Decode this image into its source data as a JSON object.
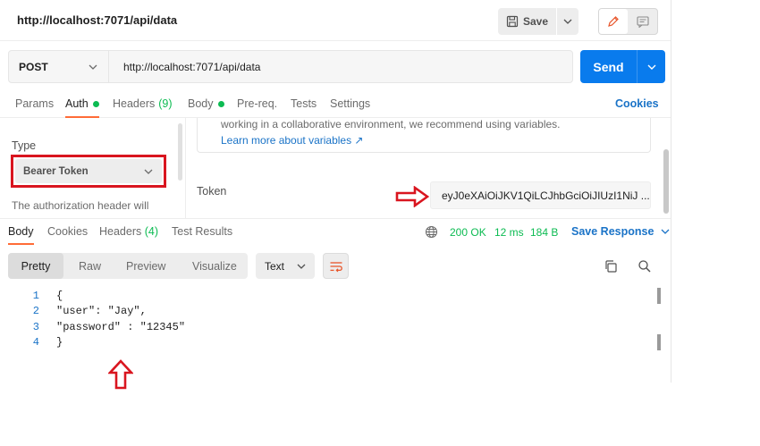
{
  "window": {
    "title": "http://localhost:7071/api/data"
  },
  "toolbar": {
    "save_label": "Save"
  },
  "request": {
    "method": "POST",
    "url": "http://localhost:7071/api/data",
    "send_label": "Send"
  },
  "request_tabs": {
    "params": "Params",
    "auth": "Auth",
    "headers": "Headers",
    "headers_count": "(9)",
    "body": "Body",
    "prereq": "Pre-req.",
    "tests": "Tests",
    "settings": "Settings",
    "cookies": "Cookies"
  },
  "auth": {
    "type_label": "Type",
    "type_value": "Bearer Token",
    "description": "The authorization header will",
    "info_text": "working in a collaborative environment, we recommend using variables.",
    "info_link": "Learn more about variables ↗",
    "token_label": "Token",
    "token_value": "eyJ0eXAiOiJKV1QiLCJhbGciOiJIUzI1NiJ ..."
  },
  "response_tabs": {
    "body": "Body",
    "cookies": "Cookies",
    "headers": "Headers",
    "headers_count": "(4)",
    "test_results": "Test Results"
  },
  "response_meta": {
    "status": "200 OK",
    "time": "12 ms",
    "size": "184 B",
    "save_response": "Save Response"
  },
  "view": {
    "pretty": "Pretty",
    "raw": "Raw",
    "preview": "Preview",
    "visualize": "Visualize",
    "format": "Text"
  },
  "code_lines": [
    {
      "n": "1",
      "text": "{"
    },
    {
      "n": "2",
      "text": "\"user\": \"Jay\","
    },
    {
      "n": "3",
      "text": "\"password\" : \"12345\""
    },
    {
      "n": "4",
      "text": "}"
    }
  ],
  "colors": {
    "accent_blue": "#097bed",
    "link_blue": "#1a73c7",
    "status_green": "#0cbb52",
    "tab_orange": "#ff6c37",
    "annotation_red": "#d9151f"
  },
  "icons": {
    "save": "floppy-disk-icon",
    "edit": "pencil-icon",
    "comment": "comment-icon",
    "network": "globe-icon",
    "wrap": "word-wrap-icon",
    "copy": "copy-icon",
    "search": "search-icon"
  }
}
